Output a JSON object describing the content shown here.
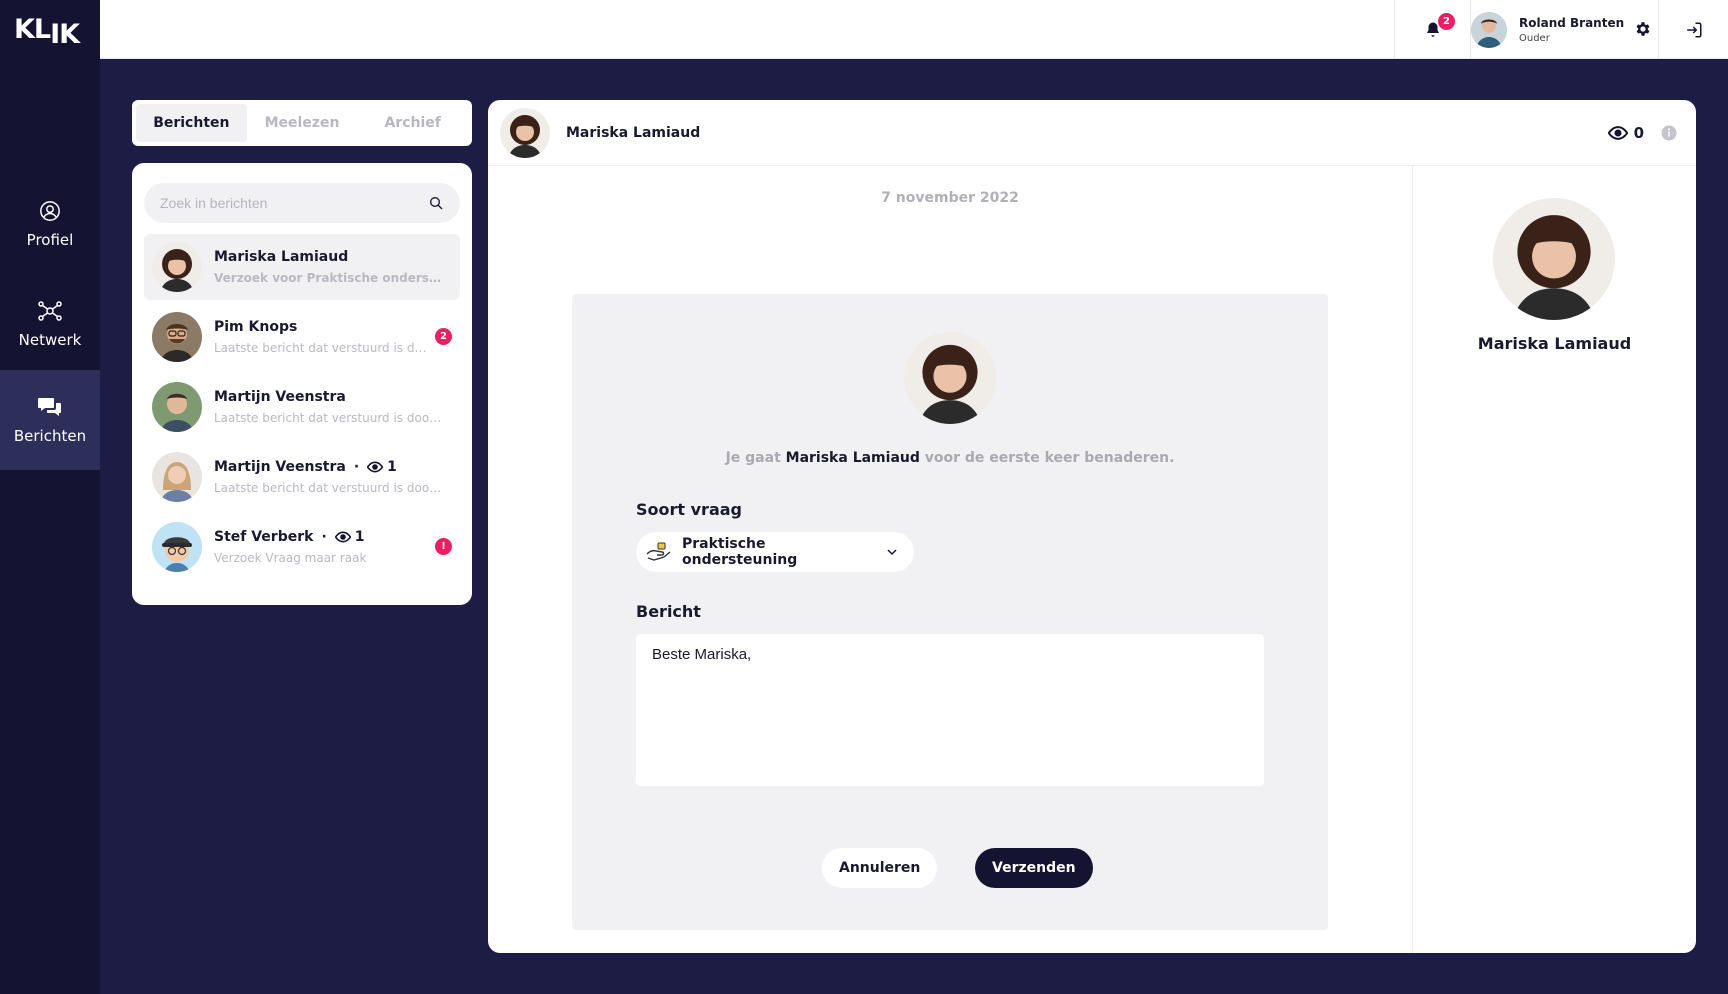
{
  "app": {
    "logo": "KLIK"
  },
  "nav": [
    {
      "label": "Profiel",
      "icon": "user-circle-icon"
    },
    {
      "label": "Netwerk",
      "icon": "network-icon"
    },
    {
      "label": "Berichten",
      "icon": "chat-bubbles-icon",
      "active": true
    }
  ],
  "topbar": {
    "notifications": "2",
    "user": {
      "name": "Roland Branten",
      "role": "Ouder"
    }
  },
  "tabs": [
    {
      "label": "Berichten",
      "active": true
    },
    {
      "label": "Meelezen"
    },
    {
      "label": "Archief"
    }
  ],
  "search": {
    "placeholder": "Zoek in berichten"
  },
  "conversations": [
    {
      "name": "Mariska Lamiaud",
      "preview": "Verzoek voor Praktische ondersteu…",
      "selected": true
    },
    {
      "name": "Pim Knops",
      "preview": "Laatste bericht dat verstuurd is d…",
      "badge": "2"
    },
    {
      "name": "Martijn Veenstra",
      "preview": "Laatste bericht dat verstuurd is door…"
    },
    {
      "name": "Martijn Veenstra",
      "views": "1",
      "preview": "Laatste bericht dat verstuurd is door…"
    },
    {
      "name": "Stef Verberk",
      "views": "1",
      "preview": "Verzoek Vraag maar raak",
      "badge": "!"
    }
  ],
  "chat": {
    "title": "Mariska Lamiaud",
    "views": "0",
    "date": "7 november 2022",
    "approach_prefix": "Je gaat ",
    "approach_name": "Mariska Lamiaud",
    "approach_suffix": " voor de eerste keer benaderen.",
    "type_label": "Soort vraag",
    "type_value": "Praktische ondersteuning",
    "message_label": "Bericht",
    "message_value": "Beste Mariska,",
    "cancel_label": "Annuleren",
    "send_label": "Verzenden"
  },
  "profile": {
    "name": "Mariska Lamiaud"
  },
  "colors": {
    "navy": "#141432",
    "background": "#1c1c45",
    "accent": "#e91e63",
    "panel_gray": "#f1f1f3"
  }
}
